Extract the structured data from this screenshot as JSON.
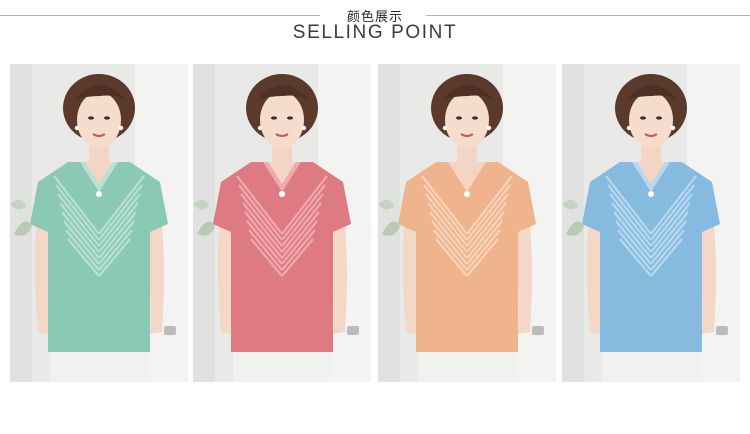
{
  "header": {
    "title_cn": "颜色展示",
    "title_en": "SELLING POINT"
  },
  "colors": {
    "rule": "#b5b5b5",
    "variants": [
      "#8cc9b5",
      "#de7a82",
      "#efb48e",
      "#86badf"
    ]
  },
  "panels": [
    {
      "shirt_color": "#8cc9b5",
      "stripe_color": "#b9e0d3"
    },
    {
      "shirt_color": "#de7a82",
      "stripe_color": "#f0a9ae"
    },
    {
      "shirt_color": "#efb48e",
      "stripe_color": "#f8d3ba"
    },
    {
      "shirt_color": "#86badf",
      "stripe_color": "#b8d8ef"
    }
  ]
}
